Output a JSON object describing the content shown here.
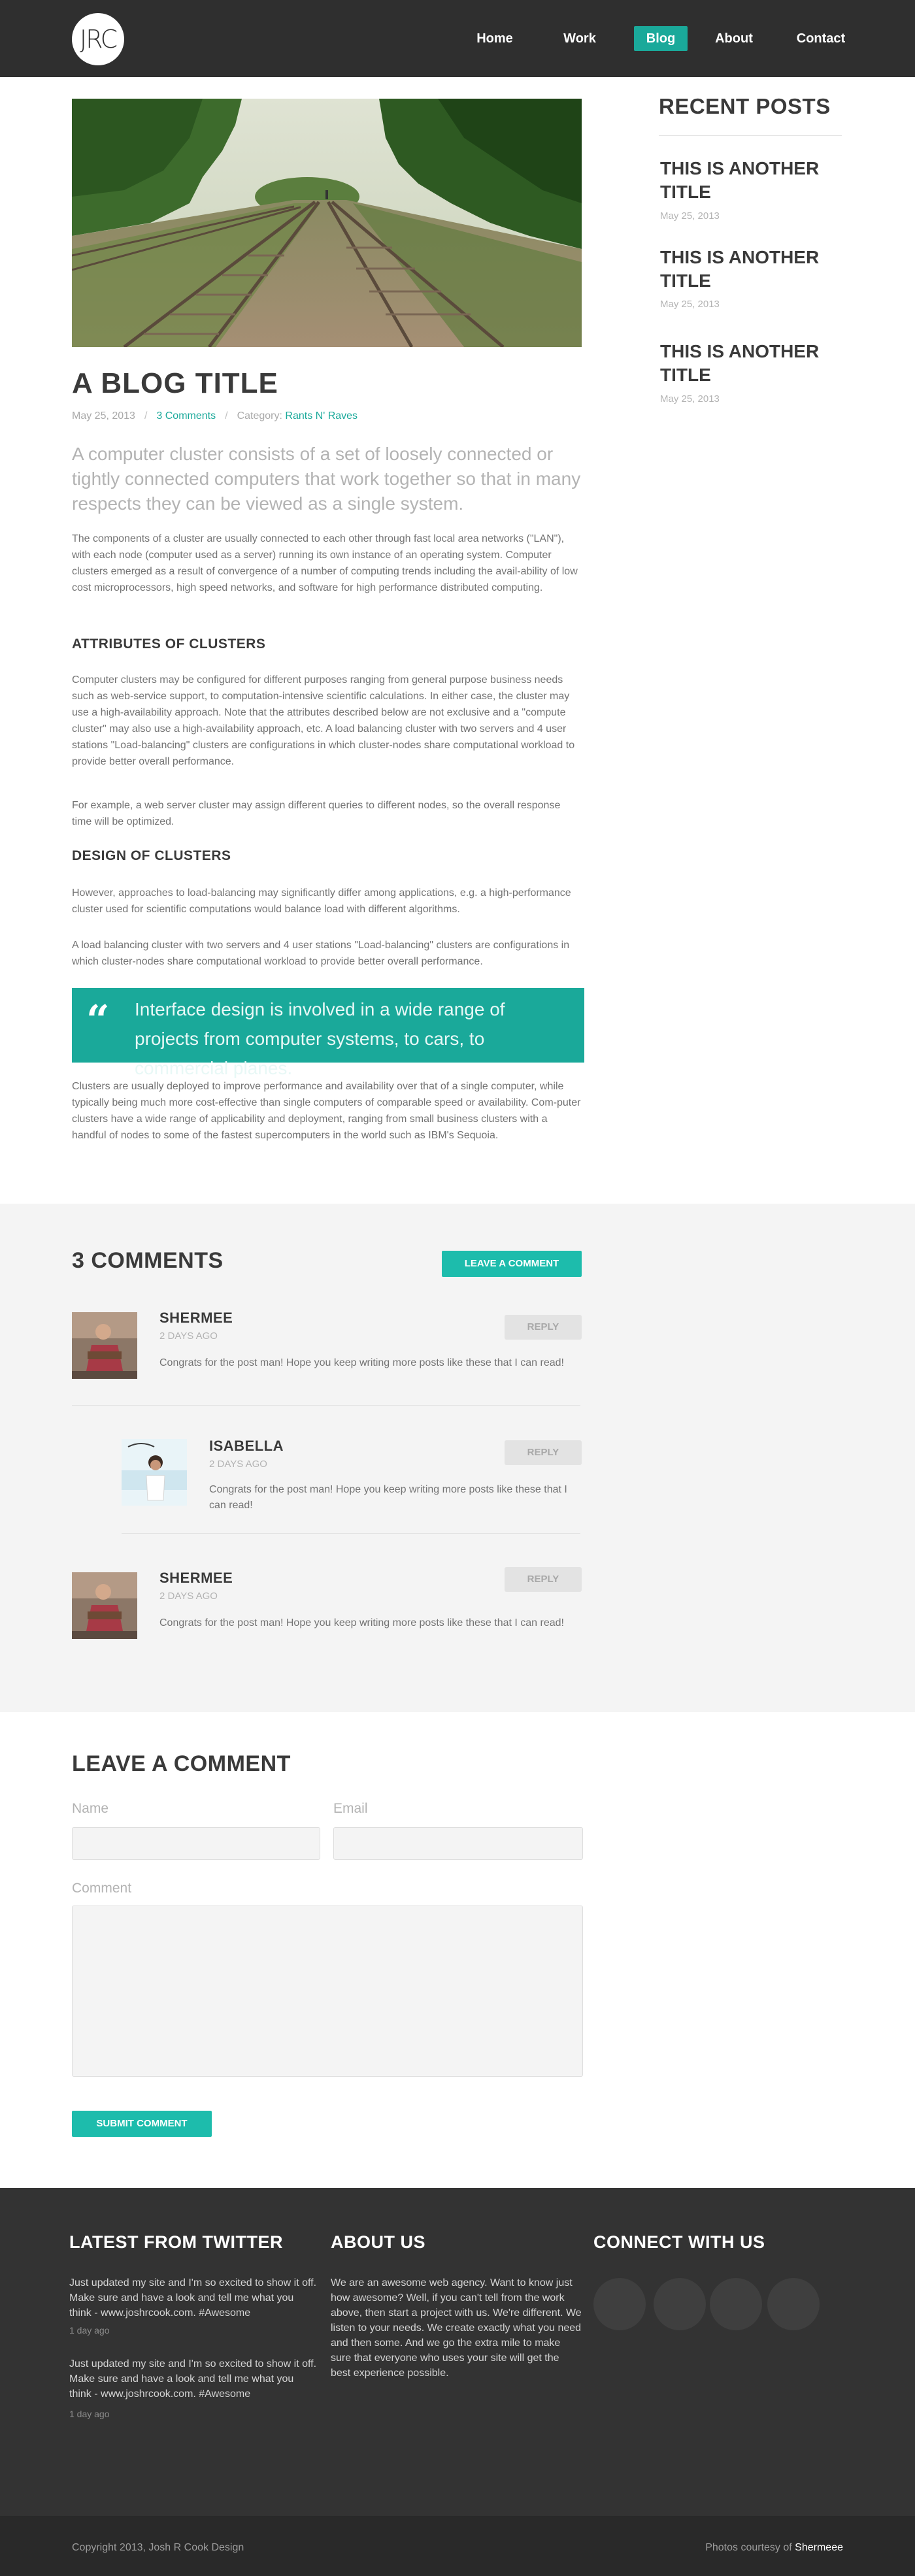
{
  "header": {
    "logo_text": "JRC",
    "nav": [
      "Home",
      "Work",
      "Blog",
      "About",
      "Contact"
    ],
    "active": "Blog",
    "accent": "#1aa99a"
  },
  "post": {
    "title": "A BLOG TITLE",
    "date": "May 25, 2013",
    "comments_link": "3 Comments",
    "category_label": "Category:",
    "category": "Rants N' Raves",
    "lead": "A computer cluster consists of a set of loosely connected or tightly connected computers that work together so that in many respects they can be viewed as a single system.",
    "p1": "The components of a cluster are usually connected to each other through fast local area networks (\"LAN\"), with each node (computer used as a server) running its own instance of an operating system. Computer clusters emerged as a result of convergence of a number of computing trends including the avail-ability of low cost microprocessors, high speed networks, and software for high performance distributed computing.",
    "h_attributes": "ATTRIBUTES OF CLUSTERS",
    "p2": "Computer clusters may be configured for different purposes ranging from general purpose business needs such as web-service support, to computation-intensive scientific calculations. In either case, the cluster may use a high-availability approach. Note that the attributes described below are not exclusive and a \"compute cluster\" may also use a high-availability approach, etc. A load balancing cluster with two servers and 4 user stations \"Load-balancing\" clusters are configurations in which cluster-nodes share computational workload to provide better overall performance.",
    "p3": "For example, a web server cluster may assign different queries to different nodes, so the overall response time will be optimized.",
    "h_design": "DESIGN OF CLUSTERS",
    "p4": "However, approaches to load-balancing may significantly differ among applications, e.g. a high-performance cluster used for scientific computations would balance load with different algorithms.",
    "p5": "A load balancing cluster with two servers and 4 user stations \"Load-balancing\" clusters are configurations in which cluster-nodes share computational workload to provide better overall performance.",
    "quote": "Interface design is involved in a wide range of projects from computer systems, to cars, to commercial planes.",
    "p6": "Clusters are usually deployed to improve performance and availability over that of a single computer, while typically being much more cost-effective than single computers of comparable speed or availability. Com-puter clusters have a wide range of applicability and deployment, ranging from small business clusters with a handful of nodes to some of the fastest supercomputers in the world such as IBM's Sequoia."
  },
  "sidebar": {
    "heading": "RECENT POSTS",
    "posts": [
      {
        "title": "THIS IS ANOTHER TITLE",
        "date": "May 25, 2013"
      },
      {
        "title": "THIS IS ANOTHER TITLE",
        "date": "May 25, 2013"
      },
      {
        "title": "THIS IS ANOTHER TITLE",
        "date": "May 25, 2013"
      }
    ]
  },
  "comments": {
    "heading": "3 COMMENTS",
    "leave_button": "LEAVE A COMMENT",
    "reply_label": "REPLY",
    "items": [
      {
        "name": "SHERMEE",
        "time": "2 DAYS AGO",
        "text": "Congrats for the post man!  Hope you keep writing more posts like these that I can read!"
      },
      {
        "name": "ISABELLA",
        "time": "2 DAYS AGO",
        "text": "Congrats for the post man!  Hope you keep writing more posts like these that I can read!"
      },
      {
        "name": "SHERMEE",
        "time": "2 DAYS AGO",
        "text": "Congrats for the post man!  Hope you keep writing more posts like these that I can read!"
      }
    ]
  },
  "form": {
    "heading": "LEAVE A COMMENT",
    "name_label": "Name",
    "email_label": "Email",
    "comment_label": "Comment",
    "name_value": "",
    "email_value": "",
    "comment_value": "",
    "submit": "SUBMIT COMMENT"
  },
  "footer": {
    "twitter_heading": "LATEST FROM TWITTER",
    "tweets": [
      {
        "text": "Just updated my site and I'm so excited to show it off.  Make sure and have a look and tell me what you think - www.joshrcook.com. #Awesome",
        "time": "1 day ago"
      },
      {
        "text": "Just updated my site and I'm so excited to show it off.  Make sure and have a look and tell me what you think - www.joshrcook.com. #Awesome",
        "time": "1 day ago"
      }
    ],
    "about_heading": "ABOUT US",
    "about_text": "We are an awesome web agency.  Want to know just how awesome?  Well, if you can't tell from the work above, then start a project with us.  We're different. We listen to your needs.  We create exactly what you need and then some.  And we go the extra mile to make sure that everyone who uses your site will get the best experience possible.",
    "connect_heading": "CONNECT WITH US",
    "copyright": "Copyright 2013, Josh R Cook Design",
    "photos_label": "Photos courtesy of",
    "photos_credit": "Shermeee"
  }
}
